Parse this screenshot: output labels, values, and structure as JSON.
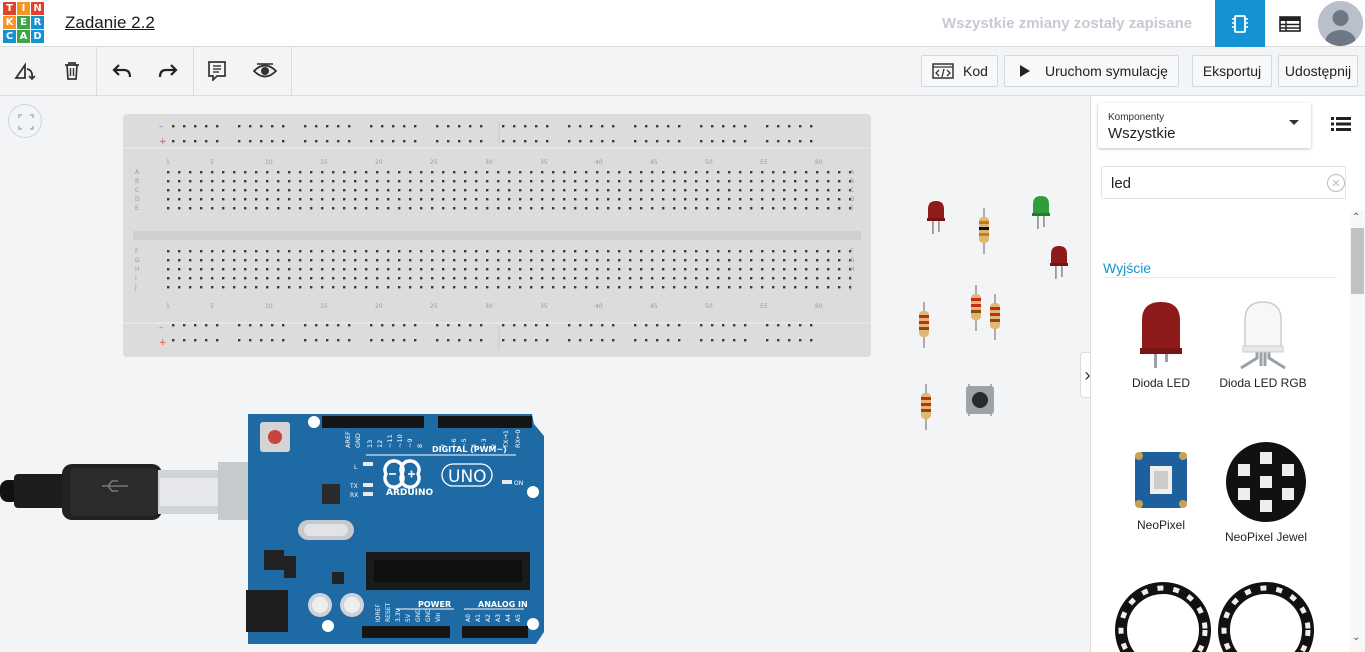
{
  "header": {
    "logo_letters": [
      "T",
      "I",
      "N",
      "K",
      "E",
      "R",
      "C",
      "A",
      "D"
    ],
    "project_title": "Zadanie 2.2",
    "save_status": "Wszystkie zmiany zostały zapisane",
    "accent_color": "#1493d4"
  },
  "toolbar": {
    "code_label": "Kod",
    "simulate_label": "Uruchom symulację",
    "export_label": "Eksportuj",
    "share_label": "Udostępnij"
  },
  "breadboard": {
    "column_numbers": [
      "1",
      "5",
      "10",
      "15",
      "20",
      "25",
      "30",
      "35",
      "40",
      "45",
      "50",
      "55",
      "60"
    ],
    "row_letters_top": [
      "A",
      "B",
      "C",
      "D",
      "E"
    ],
    "row_letters_bottom": [
      "F",
      "G",
      "H",
      "I",
      "J"
    ]
  },
  "arduino": {
    "brand": "ARDUINO",
    "model": "UNO",
    "digital_label": "DIGITAL (PWM~)",
    "power_label": "POWER",
    "analog_label": "ANALOG IN",
    "on_label": "ON",
    "l_label": "L",
    "tx_label": "TX",
    "rx_label": "RX",
    "digital_pins": [
      "AREF",
      "GND",
      "13",
      "12",
      "~11",
      "~10",
      "~9",
      "8",
      "7",
      "~6",
      "~5",
      "4",
      "~3",
      "2",
      "TX→1",
      "RX←0"
    ],
    "power_pins": [
      "IOREF",
      "RESET",
      "3.3V",
      "5V",
      "GND",
      "GND",
      "Vin"
    ],
    "analog_pins": [
      "A0",
      "A1",
      "A2",
      "A3",
      "A4",
      "A5"
    ]
  },
  "panel": {
    "category_label": "Komponenty",
    "category_value": "Wszystkie",
    "search_value": "led",
    "section_title": "Wyjście",
    "components": [
      {
        "name": "Dioda LED"
      },
      {
        "name": "Dioda LED RGB"
      },
      {
        "name": "NeoPixel"
      },
      {
        "name": "NeoPixel Jewel"
      }
    ]
  }
}
